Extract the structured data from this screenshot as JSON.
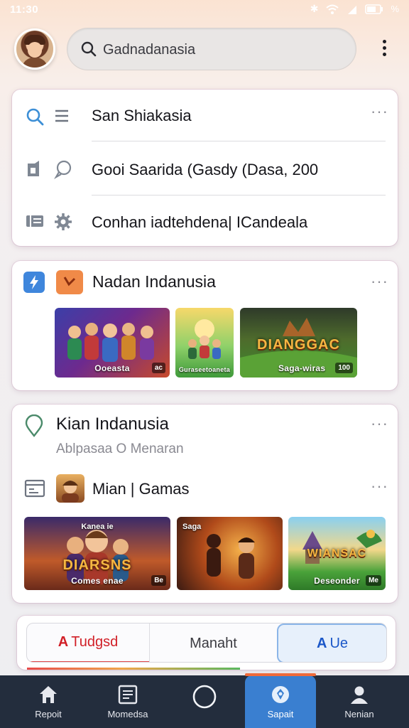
{
  "status_bar": {
    "time": "11:30",
    "battery": "%"
  },
  "header": {
    "search_text": "Gadnadanasia"
  },
  "quick_card": {
    "rows": [
      {
        "label": "San Shiakasia"
      },
      {
        "label": "Gooi Saarida (Gasdy (Dasa, 200"
      },
      {
        "label": "Conhan iadtehdena| ICandeala"
      }
    ]
  },
  "section1": {
    "title": "Nadan Indanusia",
    "thumbs": [
      {
        "caption": "Ooeasta",
        "badge": "ac"
      },
      {
        "caption": "Guraseetoaneta"
      },
      {
        "headline": "DIANGGAC",
        "caption": "Saga-wiras",
        "badge": "100"
      }
    ]
  },
  "section2": {
    "title": "Kian Indanusia",
    "subtitle": "Ablpasaa O Menaran",
    "sub_title": "Mian | Gamas",
    "thumbs": [
      {
        "top": "Kanea ie",
        "headline": "DIARSNS",
        "caption": "Comes enae",
        "badge": "Be"
      },
      {
        "top": "Saga"
      },
      {
        "headline": "WIANSAC",
        "caption": "Deseonder",
        "badge": "Me"
      }
    ]
  },
  "tabs": [
    {
      "glyph": "A",
      "label": "Tudgsd"
    },
    {
      "label": "Manaht"
    },
    {
      "glyph": "A",
      "label": "Ue"
    }
  ],
  "bottom_nav": [
    {
      "label": "Repoit",
      "icon": "home-icon"
    },
    {
      "label": "Momedsa",
      "icon": "news-icon"
    },
    {
      "label": "",
      "icon": "circle-icon"
    },
    {
      "label": "Sapait",
      "icon": "support-icon",
      "active": true
    },
    {
      "label": "Nenian",
      "icon": "profile-icon"
    }
  ],
  "colors": {
    "accent": "#3a7fd0",
    "nav_bg": "#232d3d",
    "tab_active": "#d11f27"
  }
}
